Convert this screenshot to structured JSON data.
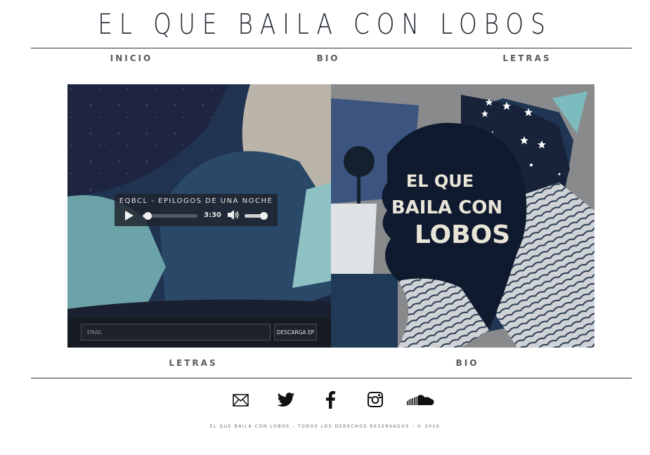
{
  "site": {
    "title": "EL QUE BAILA CON LOBOS"
  },
  "nav_top": [
    {
      "label": "INICIO"
    },
    {
      "label": "BIO"
    },
    {
      "label": "LETRAS"
    }
  ],
  "nav_bottom": [
    {
      "label": "LETRAS"
    },
    {
      "label": "BIO"
    }
  ],
  "hero": {
    "art_text": [
      "EL QUE",
      "BAILA CON",
      "LOBOS"
    ],
    "player": {
      "track_title": "EQBCL - EPILOGOS DE UNA NOCHE",
      "duration": "3:30",
      "progress": 0.1,
      "volume": 0.85
    },
    "signup": {
      "email_placeholder": "EMAIL",
      "download_label": "DESCARGA EP"
    }
  },
  "social": [
    {
      "icon": "mail-icon"
    },
    {
      "icon": "twitter-icon"
    },
    {
      "icon": "facebook-icon"
    },
    {
      "icon": "instagram-icon"
    },
    {
      "icon": "soundcloud-icon"
    }
  ],
  "footer": {
    "text": "EL QUE BAILA CON LOBOS - TODOS LOS DERECHOS RESERVADOS - © 2016"
  },
  "colors": {
    "text": "#1e2530",
    "nav": "#5a5a5a",
    "hero_dark": "#1b2236",
    "hero_teal": "#6ba3a8"
  }
}
